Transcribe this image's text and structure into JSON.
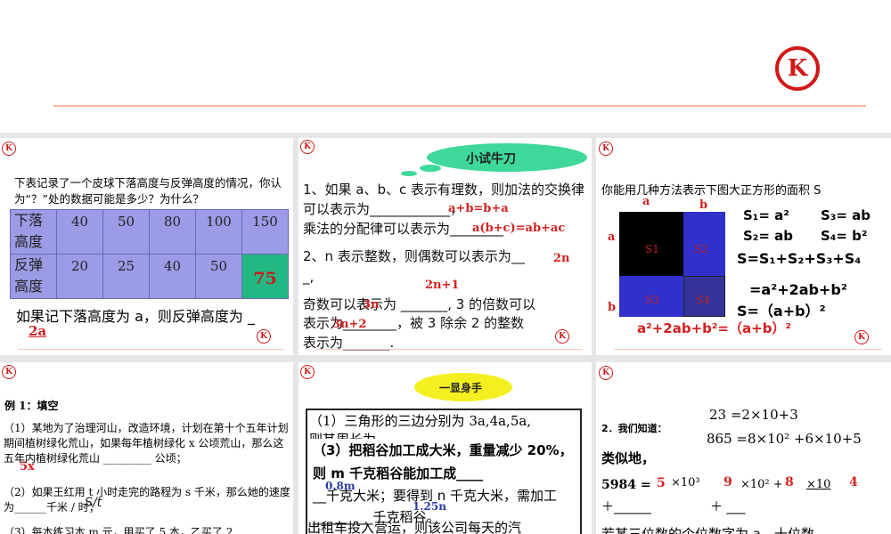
{
  "logo_text": "K",
  "slides": [
    {
      "q": "下表记录了一个皮球下落高度与反弹高度的情况，你认为“？”处的数据可能是多少？为什么？",
      "row1_label": "下落高度",
      "row1": [
        "40",
        "50",
        "80",
        "100",
        "150"
      ],
      "row2_label": "反弹高度",
      "row2": [
        "20",
        "25",
        "40",
        "50"
      ],
      "answer_cell": "75",
      "text": "如果记下落高度为 a，则反弹高度为 _",
      "answer": "2a"
    },
    {
      "cloud": "小试牛刀",
      "l1": "1、如果 a、b、c 表示有理数，则加法的交换律可以表示为____________，",
      "l2": "乘法的分配律可以表示为________",
      "a1": "a+b=b+a",
      "a2": "a(b+c)=ab+ac",
      "l3": "2、n 表示整数，则偶数可以表示为__",
      "l3b": "_,",
      "a3": "2n",
      "a4": "2n+1",
      "l4": "奇数可以表示为 _______, 3 的倍数可以",
      "l5": "表示为________，被 3 除余 2 的整数",
      "l6": "表示为_______.",
      "a5": "3n",
      "a6": "3n+2"
    },
    {
      "q": "你能用几种方法表示下图大正方形的面积 S",
      "labels": {
        "a_top": "a",
        "b_top": "b",
        "a_left": "a",
        "b_left": "b",
        "s1": "S1",
        "s2": "S2",
        "s3": "S3",
        "s4": "S4"
      },
      "f1": "S₁= a²",
      "f2": "S₃= ab",
      "f3": "S₂= ab",
      "f4": "S₄= b²",
      "f5": "S=S₁+S₂+S₃+S₄",
      "f6": "=a²+2ab+b²",
      "f7": "S=（a+b）²",
      "f8": "a²+2ab+b²=（a+b）²"
    },
    {
      "title": "例 1：填空",
      "p1": "（1）某地为了治理河山，改造环境，计划在第十个五年计划期间植树绿化荒山，如果每年植树绿化 x 公顷荒山，那么这五年内植树绿化荒山 _________ 公顷；",
      "a1": "5x",
      "p2": "（2）如果王红用 t 小时走完的路程为 s 千米，那么她的速度为______千米 / 时；",
      "a2": "S/t",
      "p3": "（3）每本练习本 m 元，甲买了 5 本，乙买了 2"
    },
    {
      "cloud": "一显身手",
      "p1": "（1）三角形的三边分别为 3a,4a,5a,",
      "p1b": "则其周长为",
      "p3": "（3）把稻谷加工成大米，重量减少 20%，则 m 千克稻谷能加工成____",
      "p3b": "__千克大米；要得到 n 千克大米，需加工_________千克稻谷。",
      "a1": "0.8m",
      "a2": "1.25n",
      "p4": "出租车投入营运，则该公司每天的汽"
    },
    {
      "intro": "2．我们知道：",
      "e1": "23 =2×10+3",
      "e2": "865 =8×10² +6×10+5",
      "similar": "类似地，",
      "e3": "5984 =",
      "x1": "×10³",
      "x2": "×10² +",
      "x3": "×10",
      "plus": "＋______",
      "plus2": "＋ ___",
      "a": [
        "5",
        "9",
        "8",
        "4"
      ],
      "last": "若某三位数的个位数字为 a，十位数"
    }
  ]
}
